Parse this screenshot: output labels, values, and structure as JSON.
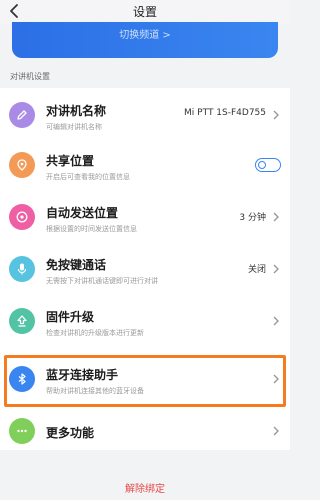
{
  "header": {
    "title": "设置"
  },
  "banner": {
    "text": "切换频道 >"
  },
  "section": {
    "label": "对讲机设置"
  },
  "rows": [
    {
      "name": "对讲机名称",
      "sub": "可编辑对讲机名称",
      "value": "Mi PTT 1S-F4D755",
      "icon": "pencil-icon",
      "color": "#a98be6"
    },
    {
      "name": "共享位置",
      "sub": "开启后可查看我的位置信息",
      "icon": "location-icon",
      "color": "#f39a56",
      "toggle": false
    },
    {
      "name": "自动发送位置",
      "sub": "根据设置的时间发送位置信息",
      "value": "3 分钟",
      "icon": "target-icon",
      "color": "#ef5fa3"
    },
    {
      "name": "免按键通话",
      "sub": "无需按下对讲机通话键即可进行对讲",
      "value": "关闭",
      "icon": "mic-icon",
      "color": "#57c3e0"
    },
    {
      "name": "固件升级",
      "sub": "检查对讲机的升级版本进行更新",
      "icon": "upload-icon",
      "color": "#52c4a5"
    },
    {
      "name": "蓝牙连接助手",
      "sub": "帮助对讲机连接其他的蓝牙设备",
      "icon": "bluetooth-icon",
      "color": "#3a86f0"
    },
    {
      "name": "更多功能",
      "icon": "more-icon",
      "color": "#7fcf5a"
    }
  ],
  "footer": {
    "unbind": "解除绑定"
  }
}
